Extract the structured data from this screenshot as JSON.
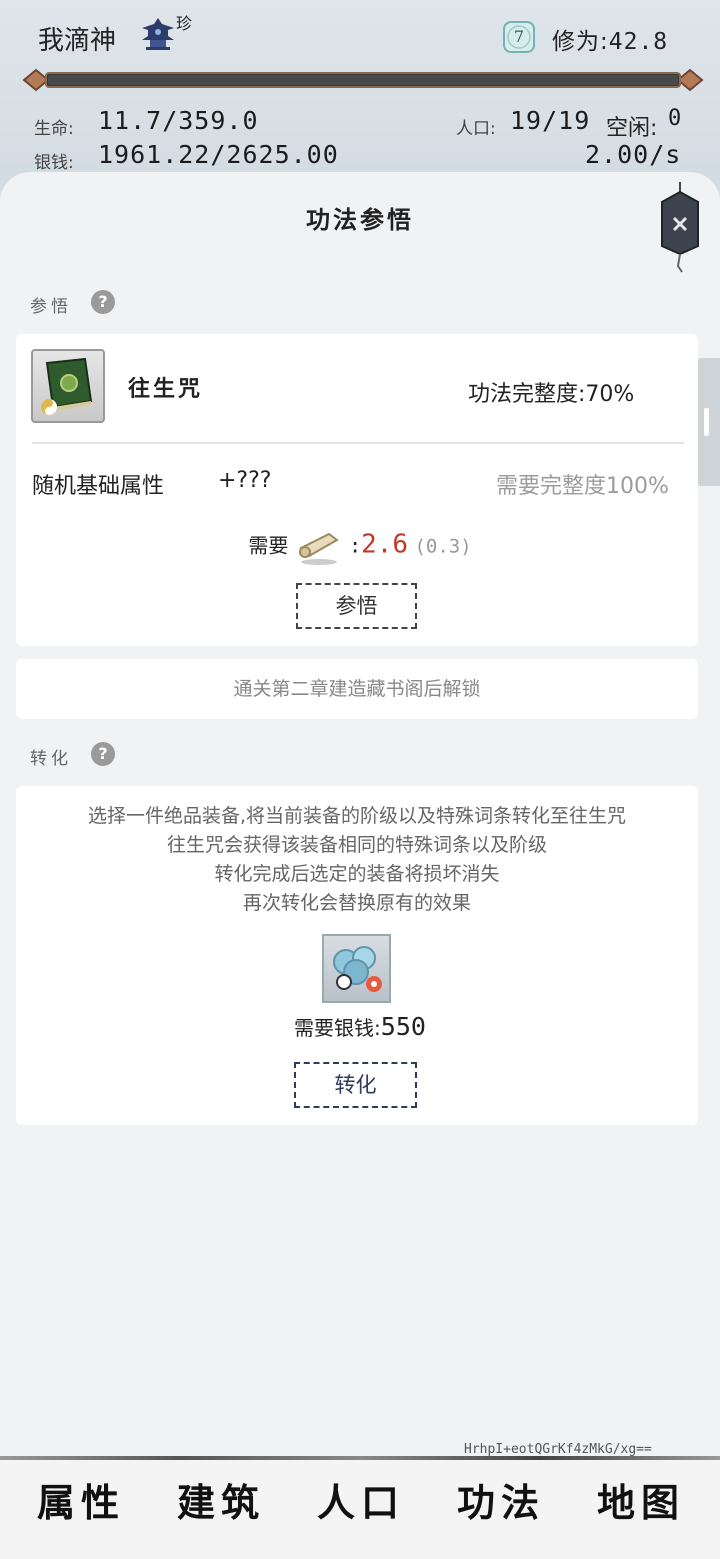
{
  "header": {
    "player_name": "我滴神",
    "rank_tag": "珍",
    "level": "7",
    "cultivation_label": "修为:",
    "cultivation_value": "42.8",
    "life_label": "生命:",
    "life_value": "11.7/359.0",
    "silver_label": "银钱:",
    "silver_value": "1961.22/2625.00",
    "population_label": "人口:",
    "population_value": "19/19",
    "idle_label": "空闲:",
    "idle_value": "0",
    "rate_value": "2.00/s"
  },
  "panel": {
    "title": "功法参悟",
    "comprehend_section": "参悟",
    "skill_name": "往生咒",
    "completeness": "功法完整度:70%",
    "random_attr_label": "随机基础属性",
    "random_attr_value": "+???",
    "random_attr_requirement": "需要完整度100%",
    "need_label": "需要",
    "need_value": "2.6",
    "need_sub": "(0.3)",
    "comprehend_button": "参悟",
    "locked_text": "通关第二章建造藏书阁后解锁",
    "transform_section": "转化",
    "transform_desc": [
      "选择一件绝品装备,将当前装备的阶级以及特殊词条转化至往生咒",
      "往生咒会获得该装备相同的特殊词条以及阶级",
      "转化完成后选定的装备将损坏消失",
      "再次转化会替换原有的效果"
    ],
    "silver_cost_label": "需要银钱:",
    "silver_cost_value": "550",
    "transform_button": "转化"
  },
  "footer": {
    "hash": "HrhpI+eotQGrKf4zMkG/xg==",
    "nav": [
      "属性",
      "建筑",
      "人口",
      "功法",
      "地图"
    ]
  },
  "colors": {
    "need_value": "#c0392b",
    "button_border": "#2f3a5c",
    "panel_bg": "#f0f2f3",
    "top_bg": "#d6dde3"
  }
}
